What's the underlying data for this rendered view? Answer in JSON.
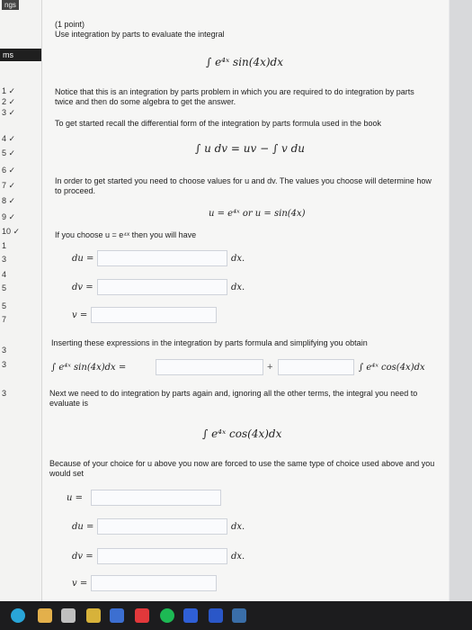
{
  "sidebar": {
    "top_label": "ngs",
    "section": "ms",
    "items": [
      "1 ✓",
      "2 ✓",
      "3 ✓",
      "4 ✓",
      "5 ✓",
      "6 ✓",
      "7 ✓",
      "8 ✓",
      "9 ✓",
      "10 ✓",
      "1",
      "3",
      "4",
      "5",
      "5",
      "7",
      "3",
      "3",
      "3"
    ]
  },
  "problem": {
    "points": "(1 point)",
    "intro": "Use integration by parts to evaluate the integral",
    "integral": "∫ e⁴ˣ sin(4x)dx",
    "notice": "Notice that this is an integration by parts problem in which you are required to do integration by parts twice and then do some algebra to get the answer.",
    "recall": "To get started recall the differential form of the integration by parts formula used in the book",
    "formula": "∫ u dv = uv − ∫ v du",
    "choose": "In order to get started you need to choose values for u and dv. The values you choose will determine how to proceed.",
    "options": "u = e⁴ˣ   or   u = sin(4x)",
    "if_choose": "If you choose u = e⁴ˣ then you will have",
    "inserting": "Inserting these expressions in the integration by parts formula and simplifying you obtain",
    "eq_left": "∫ e⁴ˣ sin(4x)dx =",
    "eq_right": "∫ e⁴ˣ cos(4x)dx",
    "next": "Next we need to do integration by parts again and, ignoring all the other terms, the integral you need to evaluate is",
    "integral2": "∫ e⁴ˣ cos(4x)dx",
    "because": "Because of your choice for u above you now are forced to use the same type of choice used above and you would set"
  },
  "labels": {
    "du": "du =",
    "dv": "dv =",
    "v": "v =",
    "u": "u =",
    "dx": "dx.",
    "plus": "+"
  }
}
